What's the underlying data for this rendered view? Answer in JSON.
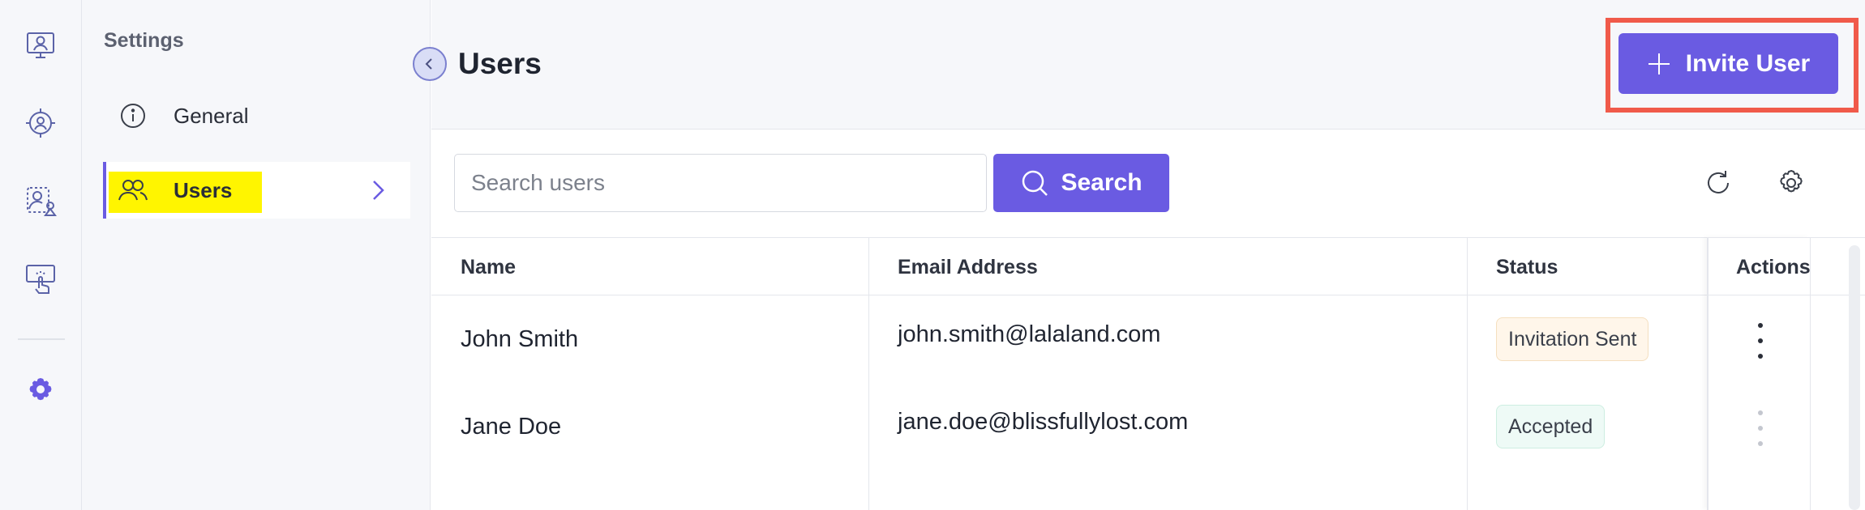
{
  "rail": {
    "items": [
      {
        "icon": "profile-monitor-icon"
      },
      {
        "icon": "target-user-icon"
      },
      {
        "icon": "user-shapes-icon"
      },
      {
        "icon": "touch-screen-icon"
      },
      {
        "icon": "gear-icon",
        "active": true
      }
    ]
  },
  "settings": {
    "title": "Settings",
    "items": [
      {
        "label": "General",
        "icon": "info-icon"
      },
      {
        "label": "Users",
        "icon": "users-icon",
        "active": true
      }
    ]
  },
  "header": {
    "title": "Users",
    "invite_label": "Invite User"
  },
  "search": {
    "placeholder": "Search users",
    "value": "",
    "button_label": "Search"
  },
  "table": {
    "columns": [
      "Name",
      "Email Address",
      "Status",
      "Actions"
    ],
    "rows": [
      {
        "name": "John Smith",
        "email": "john.smith@lalaland.com",
        "status": "Invitation Sent"
      },
      {
        "name": "Jane Doe",
        "email": "jane.doe@blissfullylost.com",
        "status": "Accepted"
      }
    ]
  },
  "colors": {
    "accent": "#6a5be2",
    "highlight_yellow": "#fff500",
    "annotation_red": "#f05a4a",
    "status_sent_bg": "#fff6ea",
    "status_accepted_bg": "#eefaf6"
  }
}
